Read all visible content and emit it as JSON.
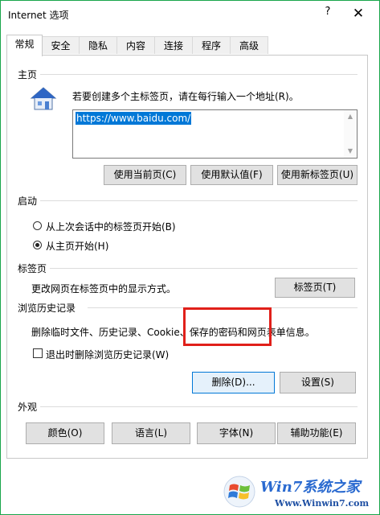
{
  "window": {
    "title": "Internet 选项",
    "help_label": "?",
    "close_label": "✕"
  },
  "tabs": [
    {
      "label": "常规",
      "active": true
    },
    {
      "label": "安全"
    },
    {
      "label": "隐私"
    },
    {
      "label": "内容"
    },
    {
      "label": "连接"
    },
    {
      "label": "程序"
    },
    {
      "label": "高级"
    }
  ],
  "homepage": {
    "section_title": "主页",
    "instruction": "若要创建多个主标签页，请在每行输入一个地址(R)。",
    "url": "https://www.baidu.com/",
    "btn_current": "使用当前页(C)",
    "btn_default": "使用默认值(F)",
    "btn_newtab": "使用新标签页(U)"
  },
  "startup": {
    "section_title": "启动",
    "option_last_session": "从上次会话中的标签页开始(B)",
    "option_homepage": "从主页开始(H)",
    "selected": "homepage"
  },
  "tabs_section": {
    "section_title": "标签页",
    "description": "更改网页在标签页中的显示方式。",
    "btn_tabs": "标签页(T)"
  },
  "history": {
    "section_title": "浏览历史记录",
    "description": "删除临时文件、历史记录、Cookie、保存的密码和网页表单信息。",
    "checkbox_label": "退出时删除浏览历史记录(W)",
    "checkbox_checked": false,
    "btn_delete": "删除(D)...",
    "btn_settings": "设置(S)"
  },
  "appearance": {
    "section_title": "外观",
    "btn_colors": "颜色(O)",
    "btn_languages": "语言(L)",
    "btn_fonts": "字体(N)",
    "btn_accessibility": "辅助功能(E)"
  },
  "watermark": {
    "title": "Win7系统之家",
    "url": "Www.Winwin7.com"
  },
  "colors": {
    "frame": "#19a64b",
    "focus": "#0078d7",
    "highlight": "#e0201a"
  }
}
